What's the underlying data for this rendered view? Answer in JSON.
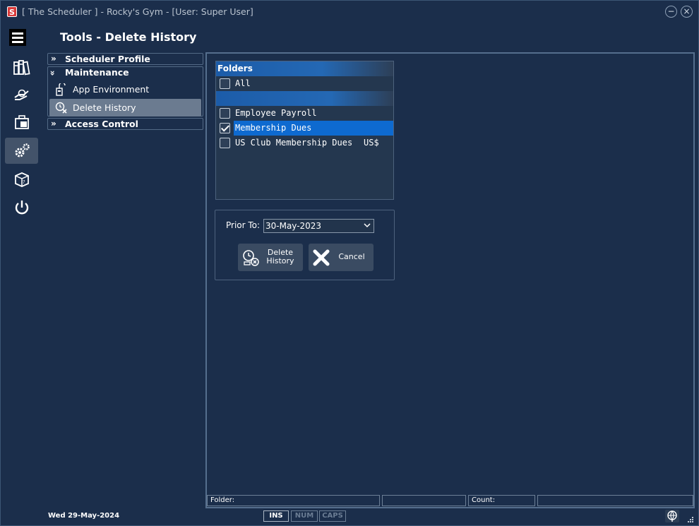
{
  "window": {
    "title": "[ The Scheduler ] - Rocky's Gym - [User: Super User]",
    "minimize": "−",
    "close": "×"
  },
  "page": {
    "title": "Tools - Delete History"
  },
  "nav": {
    "items": [
      {
        "name": "binders-icon"
      },
      {
        "name": "payment-icon"
      },
      {
        "name": "briefcase-icon"
      },
      {
        "name": "gears-icon",
        "active": true
      },
      {
        "name": "package-icon"
      },
      {
        "name": "power-icon"
      }
    ]
  },
  "tree": {
    "scheduler_profile": "Scheduler Profile",
    "maintenance": "Maintenance",
    "app_environment": "App Environment",
    "delete_history": "Delete History",
    "access_control": "Access Control",
    "chev_collapsed": "»",
    "chev_expanded": "»"
  },
  "folders": {
    "header": "Folders",
    "rows": [
      {
        "label": "All",
        "checked": false
      },
      {
        "label": "Employee Payroll",
        "checked": false
      },
      {
        "label": "Membership Dues",
        "checked": true,
        "selected": true
      },
      {
        "label": "US Club Membership Dues",
        "currency": "US$",
        "checked": false
      }
    ]
  },
  "prior": {
    "label": "Prior To:",
    "value": "30-May-2023",
    "arrow": "⌄"
  },
  "buttons": {
    "delete_line1": "Delete",
    "delete_line2": "History",
    "cancel": "Cancel"
  },
  "status": {
    "folder": "Folder:",
    "count": "Count:"
  },
  "footer": {
    "date": "Wed  29-May-2024",
    "ins": "INS",
    "num": "NUM",
    "caps": "CAPS"
  },
  "colors": {
    "background": "#1b2e4b",
    "selection": "#0e6ad0",
    "header_blue": "#1c5ca9"
  }
}
